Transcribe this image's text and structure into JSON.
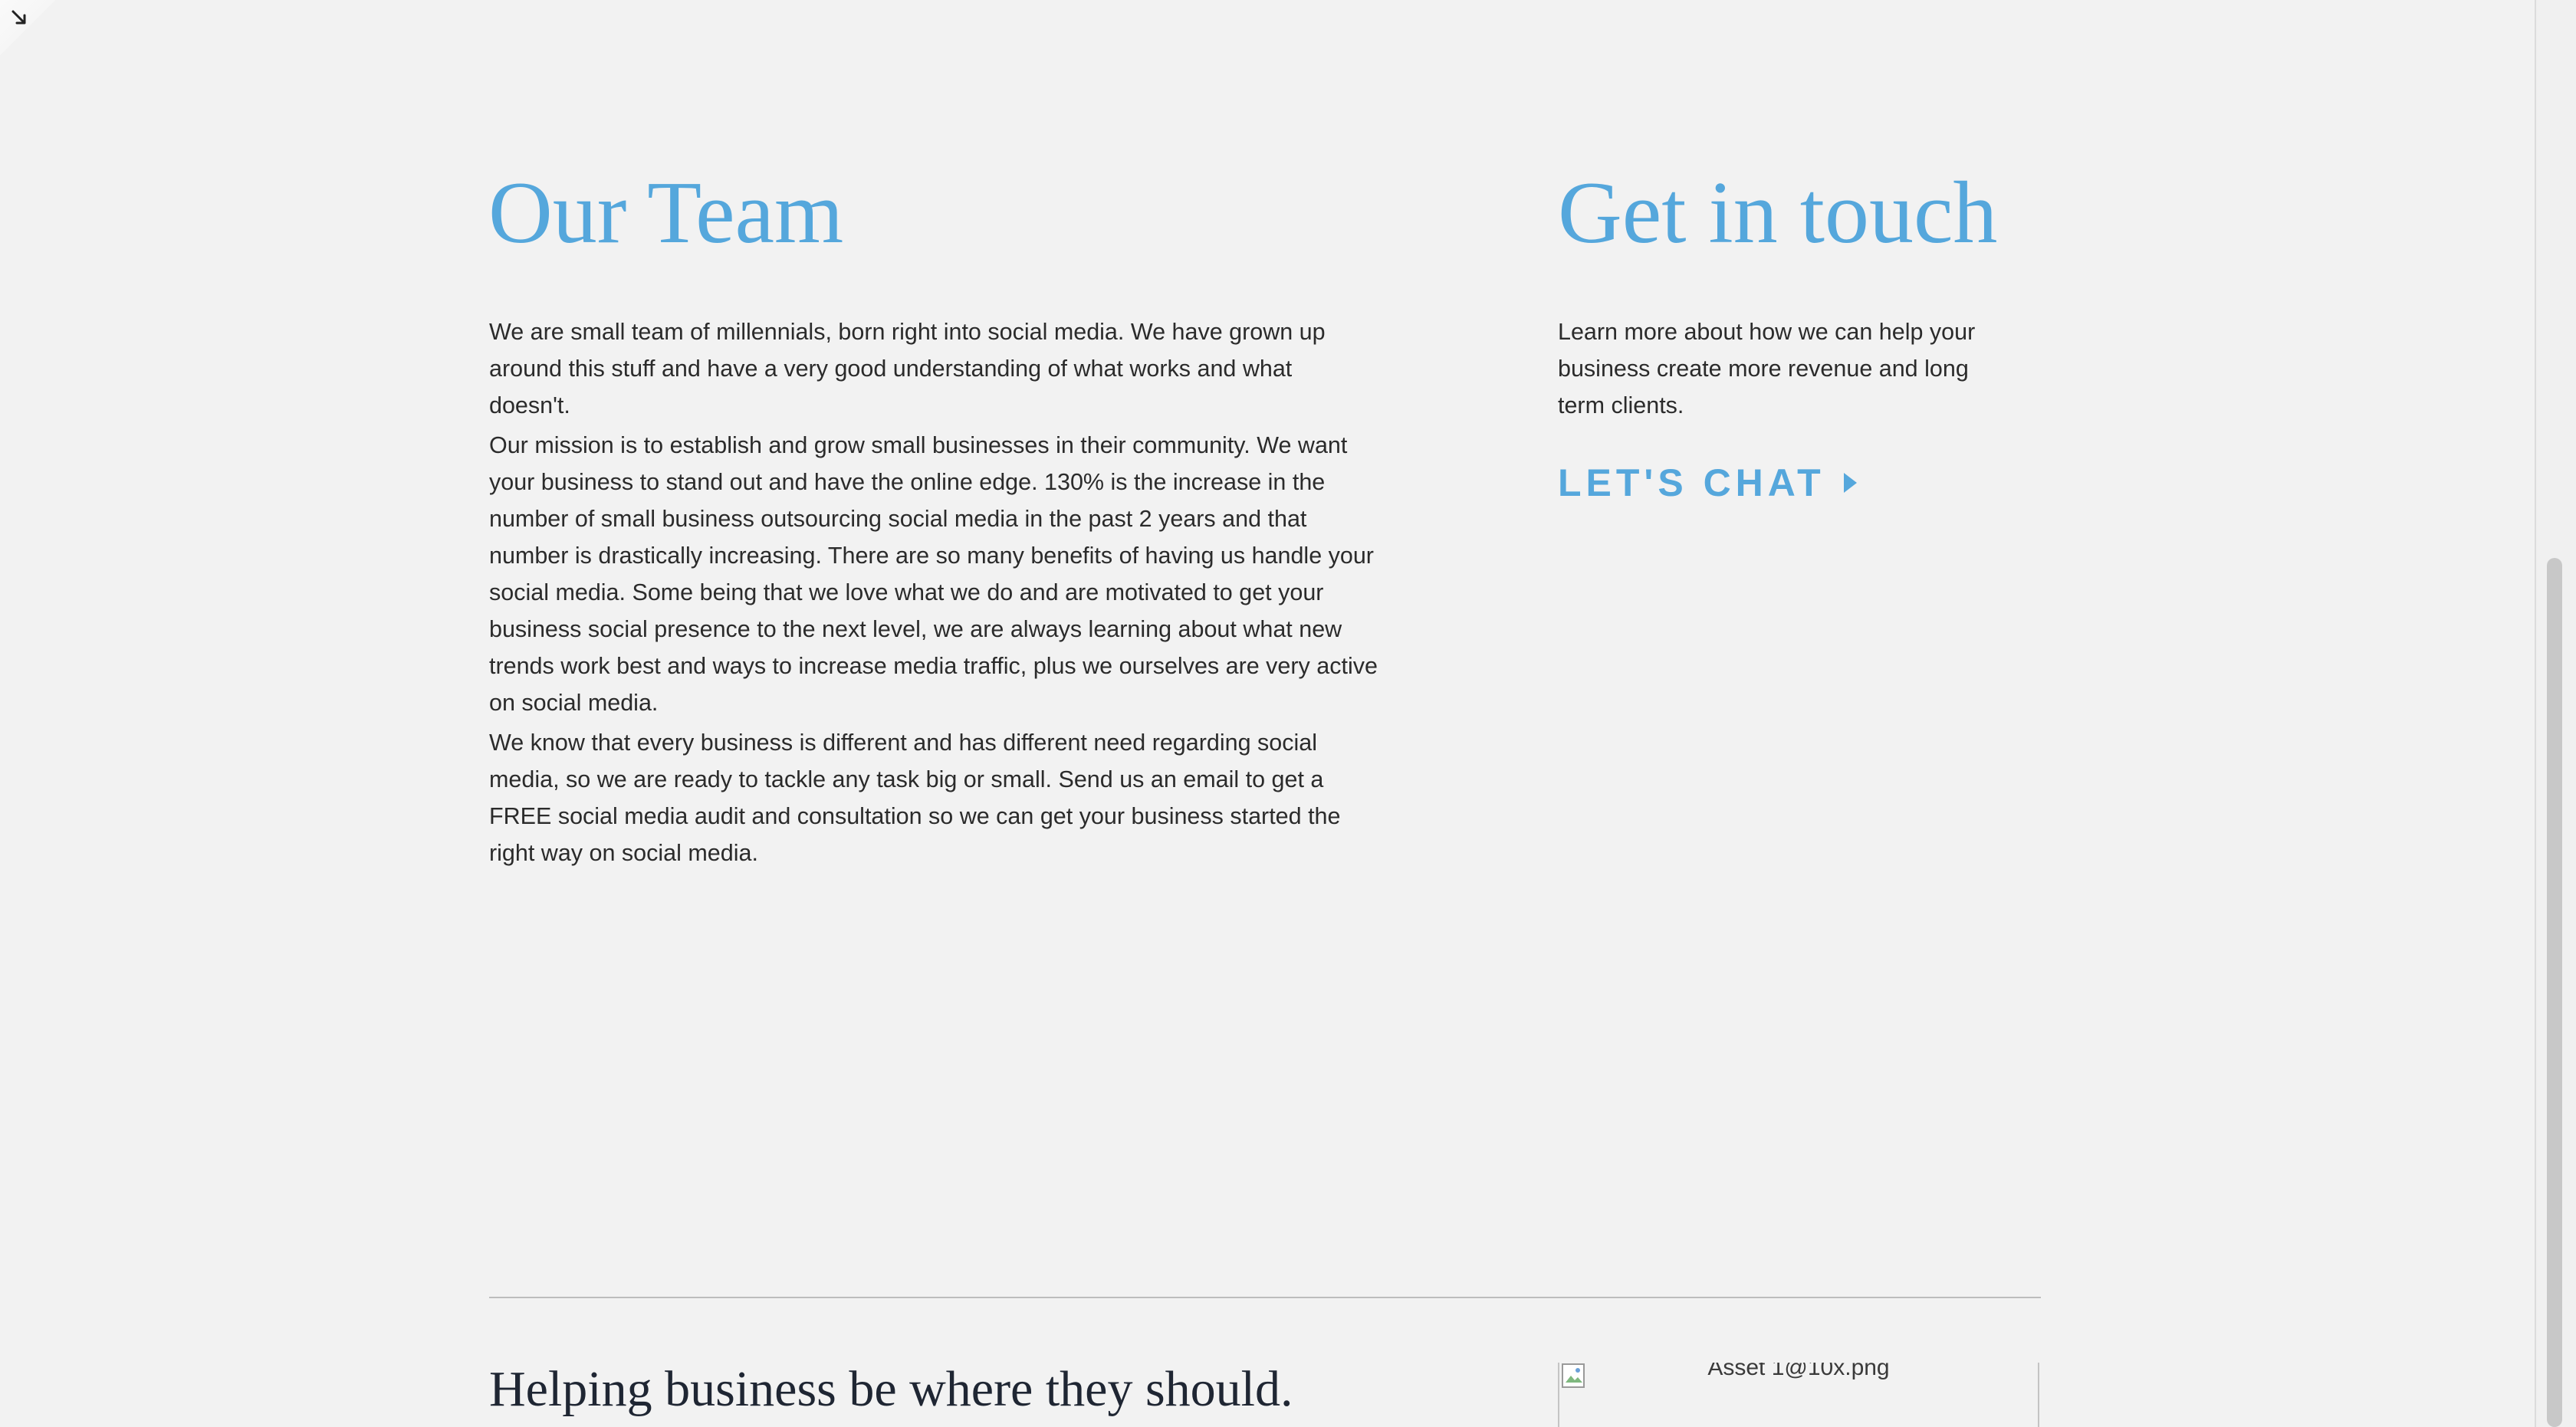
{
  "team": {
    "heading": "Our Team",
    "paragraphs": [
      "We are small team of millennials, born right into social media. We have grown up around this stuff and have a very good understanding of what works and what doesn't.",
      "Our mission is to establish and grow small businesses in their community. We want your business to stand out and have the online edge. 130% is the increase in the number of small business outsourcing social media in the past 2 years and that number is drastically increasing. There are so many benefits of having us handle your social media. Some being that we love what we do and are motivated to get your business social presence to the next level, we are always learning about what new trends work best and ways to increase media traffic, plus we ourselves are very active on social media.",
      "We know that every business is different and has different need regarding social media, so we are ready to tackle any task big or small. Send us an email to get a FREE social media audit and consultation so we can get your business started the right way on social media."
    ]
  },
  "contact": {
    "heading": "Get in touch",
    "text": "Learn more about how we can help your business create more revenue and long term clients.",
    "cta_label": "LET'S CHAT"
  },
  "footer": {
    "tagline": "Helping business be where they should.",
    "image_alt": "Asset 1@10x.png"
  },
  "colors": {
    "accent": "#55a7dc",
    "background": "#f2f2f2",
    "body_text": "#2b2b2b",
    "footer_heading": "#1f2633"
  },
  "icons": {
    "corner": "arrow-down-right-icon",
    "cta": "caret-right-icon",
    "image": "broken-image-icon"
  }
}
